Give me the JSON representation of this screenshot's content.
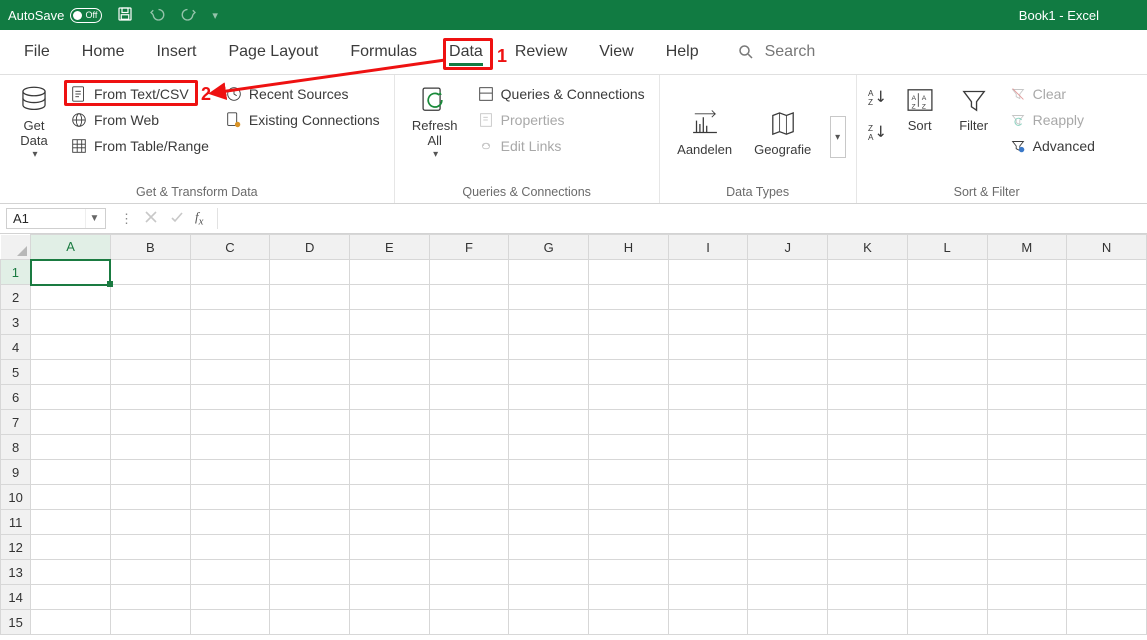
{
  "titlebar": {
    "autosave_label": "AutoSave",
    "autosave_state": "Off",
    "document_title": "Book1  -  Excel"
  },
  "tabs": {
    "file": "File",
    "home": "Home",
    "insert": "Insert",
    "page_layout": "Page Layout",
    "formulas": "Formulas",
    "data": "Data",
    "review": "Review",
    "view": "View",
    "help": "Help",
    "search": "Search"
  },
  "ribbon": {
    "get_transform": {
      "caption": "Get & Transform Data",
      "get_data": "Get Data",
      "from_text_csv": "From Text/CSV",
      "from_web": "From Web",
      "from_table_range": "From Table/Range",
      "recent_sources": "Recent Sources",
      "existing_connections": "Existing Connections"
    },
    "queries": {
      "caption": "Queries & Connections",
      "refresh_all": "Refresh All",
      "queries_connections": "Queries & Connections",
      "properties": "Properties",
      "edit_links": "Edit Links"
    },
    "data_types": {
      "caption": "Data Types",
      "aandelen": "Aandelen",
      "geografie": "Geografie"
    },
    "sort_filter": {
      "caption": "Sort & Filter",
      "sort": "Sort",
      "filter": "Filter",
      "clear": "Clear",
      "reapply": "Reapply",
      "advanced": "Advanced"
    }
  },
  "formula_bar": {
    "name_box": "A1"
  },
  "grid": {
    "columns": [
      "A",
      "B",
      "C",
      "D",
      "E",
      "F",
      "G",
      "H",
      "I",
      "J",
      "K",
      "L",
      "M",
      "N"
    ],
    "rows": [
      1,
      2,
      3,
      4,
      5,
      6,
      7,
      8,
      9,
      10,
      11,
      12,
      13,
      14,
      15
    ],
    "selected_col": "A",
    "selected_row": 1
  },
  "annotations": {
    "num1": "1",
    "num2": "2"
  }
}
